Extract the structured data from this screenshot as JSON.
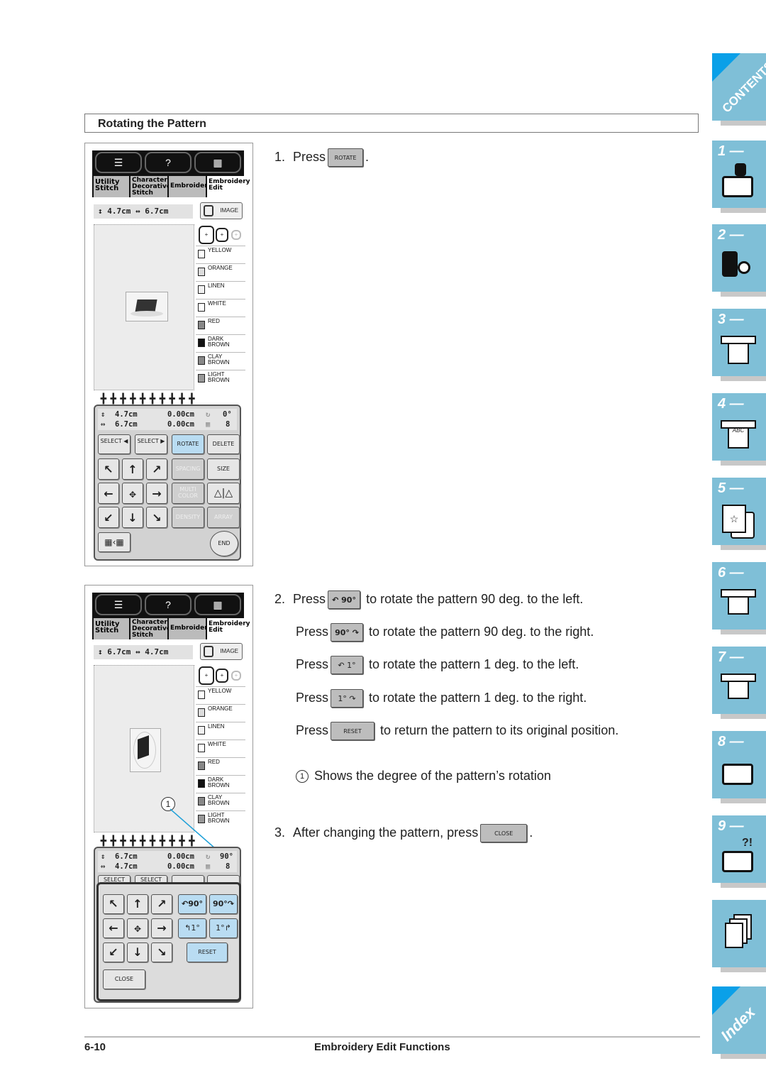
{
  "section": {
    "title": "Rotating the Pattern"
  },
  "screen1": {
    "tabs": [
      "Utility Stitch",
      "Character Decorative Stitch",
      "Embroidery",
      "Embroidery Edit"
    ],
    "size_readout": "↕ 4.7cm ↔ 6.7cm",
    "image_button": "IMAGE",
    "colors": [
      "YELLOW",
      "ORANGE",
      "LINEN",
      "WHITE",
      "RED",
      "DARK BROWN",
      "CLAY BROWN",
      "LIGHT BROWN"
    ],
    "info": {
      "height": "4.7cm",
      "width": "6.7cm",
      "offset_v": "0.00cm",
      "offset_h": "0.00cm",
      "rotation": "0°",
      "color_count": "8"
    },
    "buttons": {
      "select_prev": "SELECT ◀",
      "select_next": "SELECT ▶",
      "rotate": "ROTATE",
      "delete": "DELETE",
      "spacing": "SPACING",
      "size": "SIZE",
      "multi_color": "MULTI COLOR",
      "density": "DENSITY",
      "array": "ARRAY",
      "end": "END"
    }
  },
  "screen2": {
    "tabs": [
      "Utility Stitch",
      "Character Decorative Stitch",
      "Embroidery",
      "Embroidery Edit"
    ],
    "size_readout": "↕ 6.7cm ↔ 4.7cm",
    "image_button": "IMAGE",
    "colors": [
      "YELLOW",
      "ORANGE",
      "LINEN",
      "WHITE",
      "RED",
      "DARK BROWN",
      "CLAY BROWN",
      "LIGHT BROWN"
    ],
    "info": {
      "height": "6.7cm",
      "width": "4.7cm",
      "offset_v": "0.00cm",
      "offset_h": "0.00cm",
      "rotation": "90°",
      "color_count": "8"
    },
    "buttons": {
      "select_prev": "SELECT",
      "select_next": "SELECT",
      "rot_left_90": "90°",
      "rot_right_90": "90°",
      "rot_left_1": "1°",
      "rot_right_1": "1°",
      "reset": "RESET",
      "close": "CLOSE"
    },
    "callout": "1"
  },
  "instructions": {
    "step1": {
      "num": "1.",
      "press": "Press",
      "button": "ROTATE",
      "tail": "."
    },
    "step2": [
      {
        "num": "2.",
        "press": "Press",
        "button": "↶ 90°",
        "text": "to rotate the pattern 90 deg. to the left."
      },
      {
        "num": "",
        "press": "Press",
        "button": "90° ↷",
        "text": "to rotate the pattern 90 deg. to the right."
      },
      {
        "num": "",
        "press": "Press",
        "button": "↶ 1°",
        "text": "to rotate the pattern 1 deg. to the left."
      },
      {
        "num": "",
        "press": "Press",
        "button": "1° ↷",
        "text": "to rotate the pattern 1 deg. to the right."
      },
      {
        "num": "",
        "press": "Press",
        "button": "RESET",
        "text": "to return the pattern to its original position."
      }
    ],
    "note": {
      "num": "1",
      "text": "Shows the degree of the pattern’s rotation"
    },
    "step3": {
      "num": "3.",
      "text": "After changing the pattern, press",
      "button": "CLOSE",
      "tail": "."
    }
  },
  "side_tabs": [
    {
      "label": "CONTENTS"
    },
    {
      "label": "1 —"
    },
    {
      "label": "2 —"
    },
    {
      "label": "3 —"
    },
    {
      "label": "4 —"
    },
    {
      "label": "5 —"
    },
    {
      "label": "6 —"
    },
    {
      "label": "7 —"
    },
    {
      "label": "8 —"
    },
    {
      "label": "9 —"
    },
    {
      "label": ""
    },
    {
      "label": "Index"
    }
  ],
  "footer": {
    "page": "6-10",
    "title": "Embroidery Edit Functions"
  },
  "colors": {
    "tab_blue": "#7fbfd7",
    "corner_blue": "#0aa0e8",
    "button_blue": "#b9dcf2"
  }
}
